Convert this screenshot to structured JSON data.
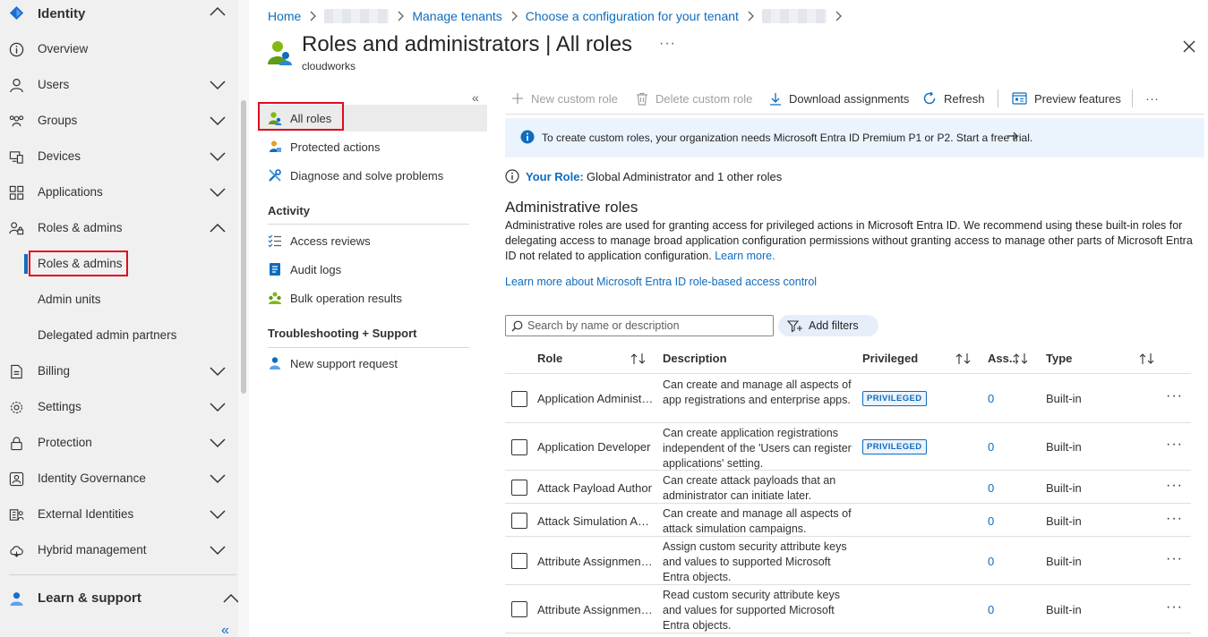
{
  "nav": {
    "section_title": "Identity",
    "items": [
      {
        "label": "Overview",
        "icon": "info-icon"
      },
      {
        "label": "Users",
        "icon": "user-icon"
      },
      {
        "label": "Groups",
        "icon": "groups-icon"
      },
      {
        "label": "Devices",
        "icon": "devices-icon"
      },
      {
        "label": "Applications",
        "icon": "applications-icon"
      },
      {
        "label": "Roles & admins",
        "icon": "roles-icon"
      }
    ],
    "sub_items": [
      "Roles & admins",
      "Admin units",
      "Delegated admin partners"
    ],
    "items2": [
      {
        "label": "Billing",
        "icon": "billing-icon"
      },
      {
        "label": "Settings",
        "icon": "gear-icon"
      },
      {
        "label": "Protection",
        "icon": "lock-icon"
      },
      {
        "label": "Identity Governance",
        "icon": "governance-icon"
      },
      {
        "label": "External Identities",
        "icon": "external-identities-icon"
      },
      {
        "label": "Hybrid management",
        "icon": "cloud-icon"
      }
    ],
    "learn_support": "Learn & support",
    "collapse_glyph": "«"
  },
  "breadcrumb": {
    "home": "Home",
    "manage_tenants": "Manage tenants",
    "choose_config": "Choose a configuration for your tenant"
  },
  "page": {
    "title": "Roles and administrators | All roles",
    "subtitle": "cloudworks",
    "more": "···"
  },
  "resource_menu": {
    "collapse_glyph": "«",
    "items": [
      "All roles",
      "Protected actions",
      "Diagnose and solve problems"
    ],
    "activity_heading": "Activity",
    "activity_items": [
      "Access reviews",
      "Audit logs",
      "Bulk operation results"
    ],
    "support_heading": "Troubleshooting + Support",
    "support_items": [
      "New support request"
    ]
  },
  "toolbar": {
    "new_custom_role": "New custom role",
    "delete_custom_role": "Delete custom role",
    "download_assignments": "Download assignments",
    "refresh": "Refresh",
    "preview_features": "Preview features",
    "more": "···"
  },
  "banner": {
    "text": "To create custom roles, your organization needs Microsoft Entra ID Premium P1 or P2. Start a free trial."
  },
  "your_role": {
    "label": "Your Role:",
    "value": "Global Administrator and 1 other roles"
  },
  "admin_roles": {
    "heading": "Administrative roles",
    "description": "Administrative roles are used for granting access for privileged actions in Microsoft Entra ID. We recommend using these built-in roles for delegating access to manage broad application configuration permissions without granting access to manage other parts of Microsoft Entra ID not related to application configuration.",
    "learn_more": "Learn more.",
    "rbac_link": "Learn more about Microsoft Entra ID role-based access control"
  },
  "search": {
    "placeholder": "Search by name or description",
    "add_filters": "Add filters"
  },
  "table": {
    "headers": {
      "role": "Role",
      "description": "Description",
      "privileged": "Privileged",
      "assignments": "Ass...",
      "type": "Type"
    },
    "rows": [
      {
        "role": "Application Administrator",
        "description": "Can create and manage all aspects of app registrations and enterprise apps.",
        "privileged": "PRIVILEGED",
        "assignments": "0",
        "type": "Built-in"
      },
      {
        "role": "Application Developer",
        "description": "Can create application registrations independent of the 'Users can register applications' setting.",
        "privileged": "PRIVILEGED",
        "assignments": "0",
        "type": "Built-in"
      },
      {
        "role": "Attack Payload Author",
        "description": "Can create attack payloads that an administrator can initiate later.",
        "privileged": "",
        "assignments": "0",
        "type": "Built-in"
      },
      {
        "role": "Attack Simulation Administrator",
        "description": "Can create and manage all aspects of attack simulation campaigns.",
        "privileged": "",
        "assignments": "0",
        "type": "Built-in"
      },
      {
        "role": "Attribute Assignment Administrator",
        "description": "Assign custom security attribute keys and values to supported Microsoft Entra objects.",
        "privileged": "",
        "assignments": "0",
        "type": "Built-in"
      },
      {
        "role": "Attribute Assignment Reader",
        "description": "Read custom security attribute keys and values for supported Microsoft Entra objects.",
        "privileged": "",
        "assignments": "0",
        "type": "Built-in"
      }
    ],
    "row_more": "···"
  }
}
